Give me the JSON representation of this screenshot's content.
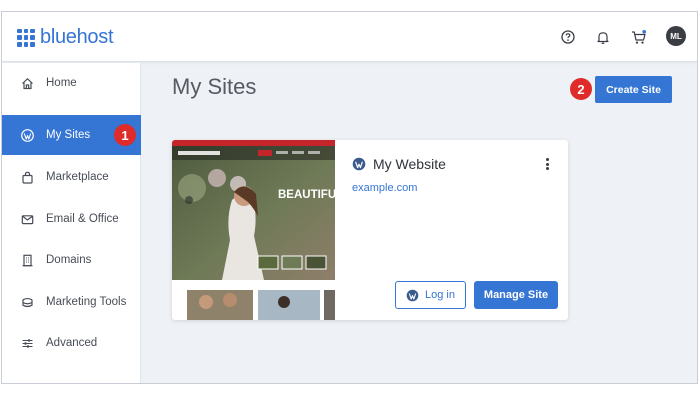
{
  "brand": {
    "name": "bluehost",
    "color": "#3575d3"
  },
  "header": {
    "icons": [
      "help-circle-icon",
      "bell-icon",
      "cart-icon"
    ],
    "avatar_initials": "ML"
  },
  "sidebar": {
    "items": [
      {
        "label": "Home",
        "icon": "home-icon",
        "active": false
      },
      {
        "label": "My Sites",
        "icon": "wordpress-icon",
        "active": true
      },
      {
        "label": "Marketplace",
        "icon": "shopping-bag-icon",
        "active": false
      },
      {
        "label": "Email & Office",
        "icon": "mail-icon",
        "active": false
      },
      {
        "label": "Domains",
        "icon": "building-icon",
        "active": false
      },
      {
        "label": "Marketing Tools",
        "icon": "stack-icon",
        "active": false
      },
      {
        "label": "Advanced",
        "icon": "sliders-icon",
        "active": false
      }
    ]
  },
  "annotations": {
    "step1": "1",
    "step2": "2",
    "color": "#e02b2b"
  },
  "main": {
    "title": "My Sites",
    "create_button": "Create Site",
    "site_card": {
      "name": "My Website",
      "url": "example.com",
      "login_button": "Log in",
      "manage_button": "Manage Site",
      "thumbnail": {
        "brand": "Photography",
        "hero_text": "BEAUTIFUL"
      }
    }
  }
}
